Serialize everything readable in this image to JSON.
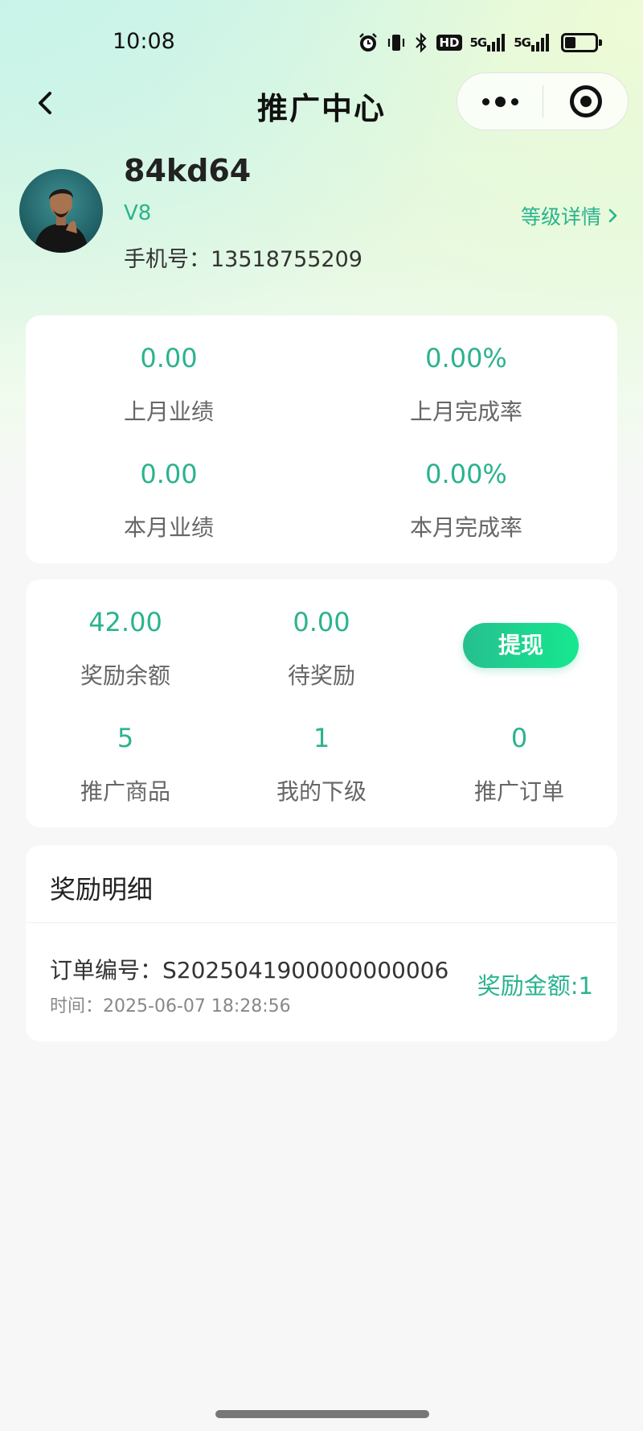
{
  "status_bar": {
    "time": "10:08",
    "icons": [
      "alarm-icon",
      "vibrate-icon",
      "bluetooth-icon",
      "hd-icon",
      "signal-5g-icon",
      "signal-5g-icon-2",
      "battery-icon"
    ],
    "hd_text": "HD",
    "net1": "5G",
    "net2": "5G",
    "battery_level": 0.35
  },
  "nav": {
    "title": "推广中心"
  },
  "profile": {
    "username": "84kd64",
    "level": "V8",
    "phone_label": "手机号：",
    "phone": "13518755209",
    "level_detail": "等级详情"
  },
  "performance": {
    "items": [
      {
        "value": "0.00",
        "label": "上月业绩"
      },
      {
        "value": "0.00%",
        "label": "上月完成率"
      },
      {
        "value": "0.00",
        "label": "本月业绩"
      },
      {
        "value": "0.00%",
        "label": "本月完成率"
      }
    ]
  },
  "rewards": {
    "items": [
      {
        "value": "42.00",
        "label": "奖励余额"
      },
      {
        "value": "0.00",
        "label": "待奖励"
      },
      {
        "value": "5",
        "label": "推广商品"
      },
      {
        "value": "1",
        "label": "我的下级"
      },
      {
        "value": "0",
        "label": "推广订单"
      }
    ],
    "withdraw_label": "提现"
  },
  "detail": {
    "title": "奖励明细",
    "records": [
      {
        "order_label": "订单编号：",
        "order_no": "S2025041900000000006",
        "time_label": "时间：",
        "time": "2025-06-07 18:28:56",
        "reward_label": "奖励金额:",
        "reward_value": "1"
      }
    ]
  },
  "colors": {
    "accent": "#2ab38f",
    "button_gradient_start": "#26bf8f",
    "button_gradient_end": "#16e88f"
  }
}
